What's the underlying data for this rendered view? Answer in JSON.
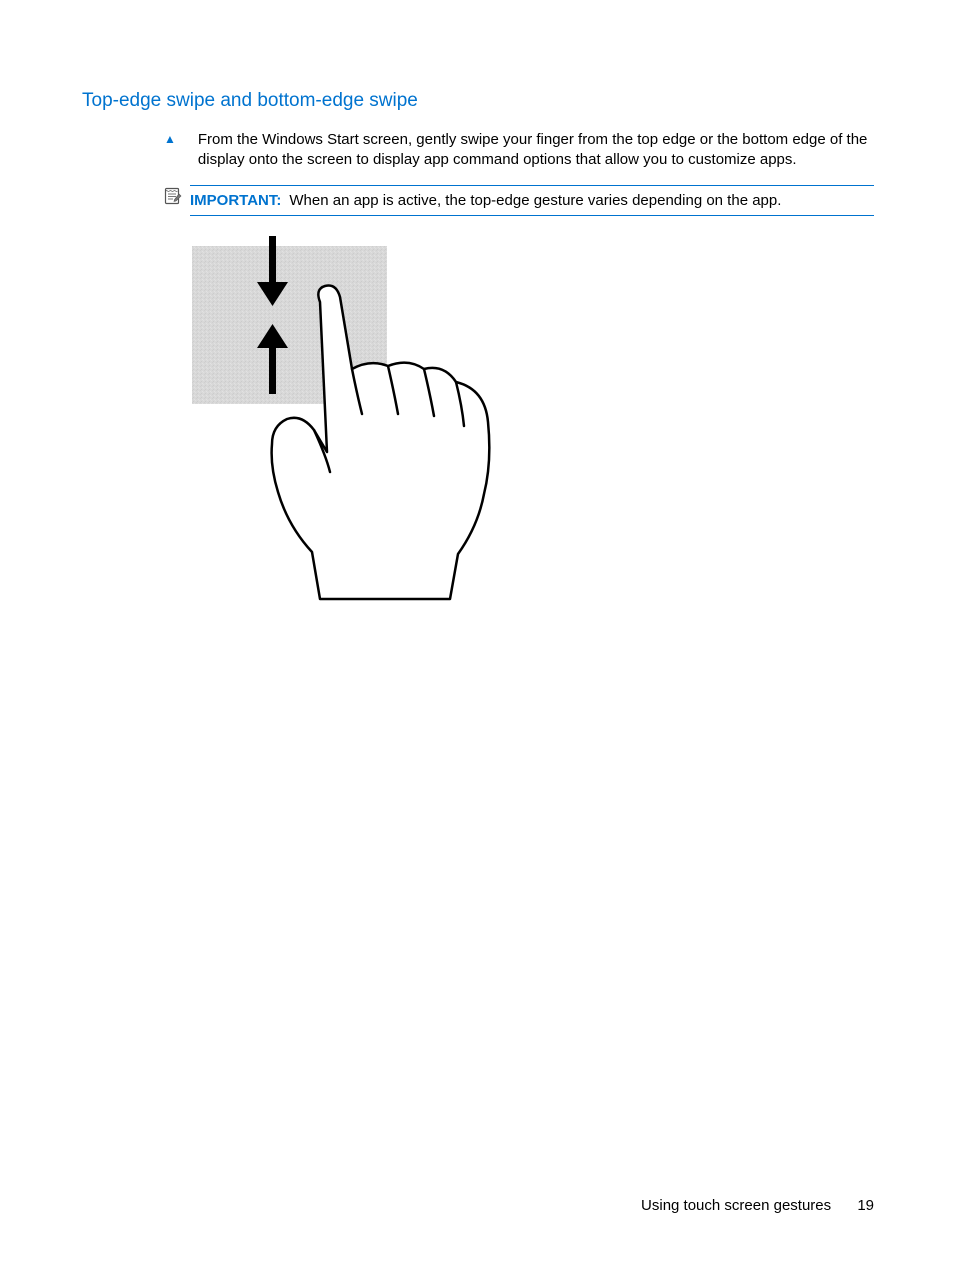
{
  "heading": "Top-edge swipe and bottom-edge swipe",
  "instruction": "From the Windows Start screen, gently swipe your finger from the top edge or the bottom edge of the display onto the screen to display app command options that allow you to customize apps.",
  "note": {
    "label": "IMPORTANT:",
    "text": "When an app is active, the top-edge gesture varies depending on the app."
  },
  "footer": {
    "section": "Using touch screen gestures",
    "page": "19"
  }
}
